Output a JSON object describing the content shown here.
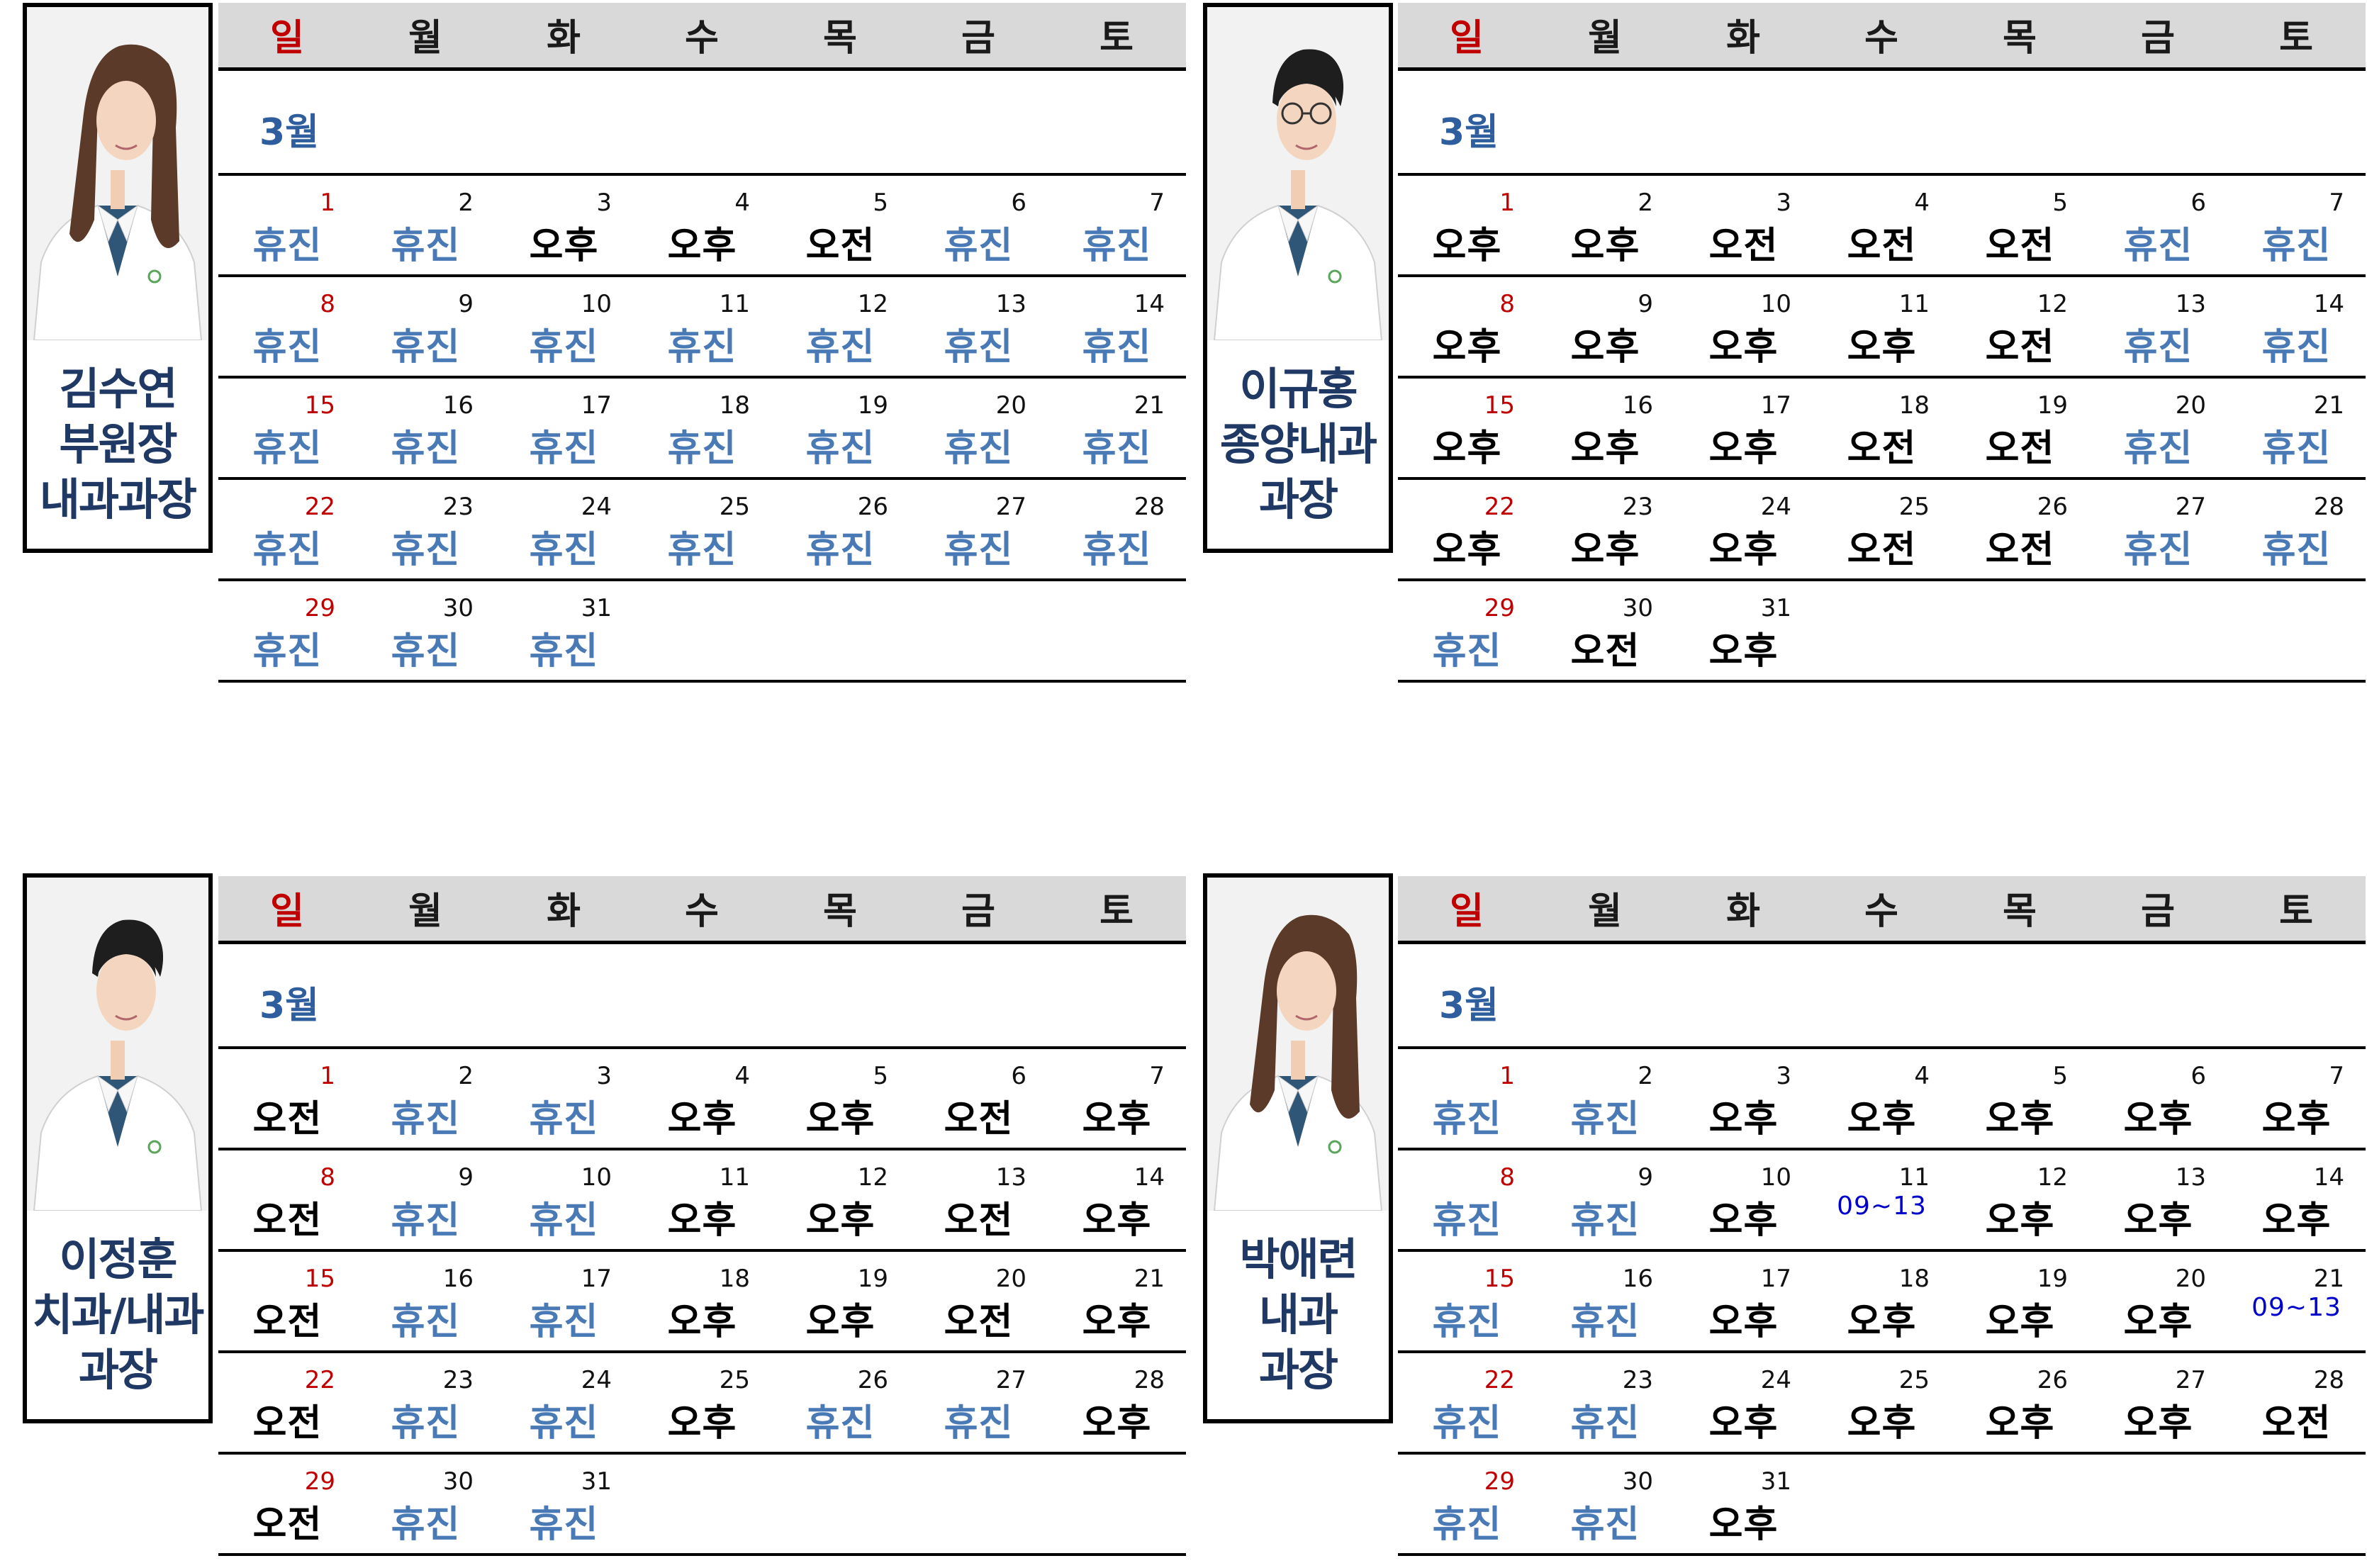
{
  "weekdays": [
    "일",
    "월",
    "화",
    "수",
    "목",
    "금",
    "토"
  ],
  "colors": {
    "sunday": "#c00000",
    "off": "#4a7ab5",
    "name": "#1f3864",
    "month": "#2e5e9e",
    "time": "#0000cc"
  },
  "panels": [
    {
      "doctor_name": [
        "김수연",
        "부원장",
        "내과과장"
      ],
      "month_label": "3월",
      "schedule": [
        "휴진",
        "휴진",
        "오후",
        "오후",
        "오전",
        "휴진",
        "휴진",
        "휴진",
        "휴진",
        "휴진",
        "휴진",
        "휴진",
        "휴진",
        "휴진",
        "휴진",
        "휴진",
        "휴진",
        "휴진",
        "휴진",
        "휴진",
        "휴진",
        "휴진",
        "휴진",
        "휴진",
        "휴진",
        "휴진",
        "휴진",
        "휴진",
        "휴진",
        "휴진",
        "휴진"
      ]
    },
    {
      "doctor_name": [
        "이규홍",
        "종양내과",
        "과장"
      ],
      "month_label": "3월",
      "schedule": [
        "오후",
        "오후",
        "오전",
        "오전",
        "오전",
        "휴진",
        "휴진",
        "오후",
        "오후",
        "오후",
        "오후",
        "오전",
        "휴진",
        "휴진",
        "오후",
        "오후",
        "오후",
        "오전",
        "오전",
        "휴진",
        "휴진",
        "오후",
        "오후",
        "오후",
        "오전",
        "오전",
        "휴진",
        "휴진",
        "휴진",
        "오전",
        "오후"
      ]
    },
    {
      "doctor_name": [
        "이정훈",
        "치과/내과",
        "과장"
      ],
      "month_label": "3월",
      "schedule": [
        "오전",
        "휴진",
        "휴진",
        "오후",
        "오후",
        "오전",
        "오후",
        "오전",
        "휴진",
        "휴진",
        "오후",
        "오후",
        "오전",
        "오후",
        "오전",
        "휴진",
        "휴진",
        "오후",
        "오후",
        "오전",
        "오후",
        "오전",
        "휴진",
        "휴진",
        "오후",
        "휴진",
        "휴진",
        "오후",
        "오전",
        "휴진",
        "휴진"
      ]
    },
    {
      "doctor_name": [
        "박애련",
        "내과",
        "과장"
      ],
      "month_label": "3월",
      "schedule": [
        "휴진",
        "휴진",
        "오후",
        "오후",
        "오후",
        "오후",
        "오후",
        "휴진",
        "휴진",
        "오후",
        "09~13",
        "오후",
        "오후",
        "오후",
        "휴진",
        "휴진",
        "오후",
        "오후",
        "오후",
        "오후",
        "09~13",
        "휴진",
        "휴진",
        "오후",
        "오후",
        "오후",
        "오후",
        "오전",
        "휴진",
        "휴진",
        "오후"
      ]
    }
  ]
}
